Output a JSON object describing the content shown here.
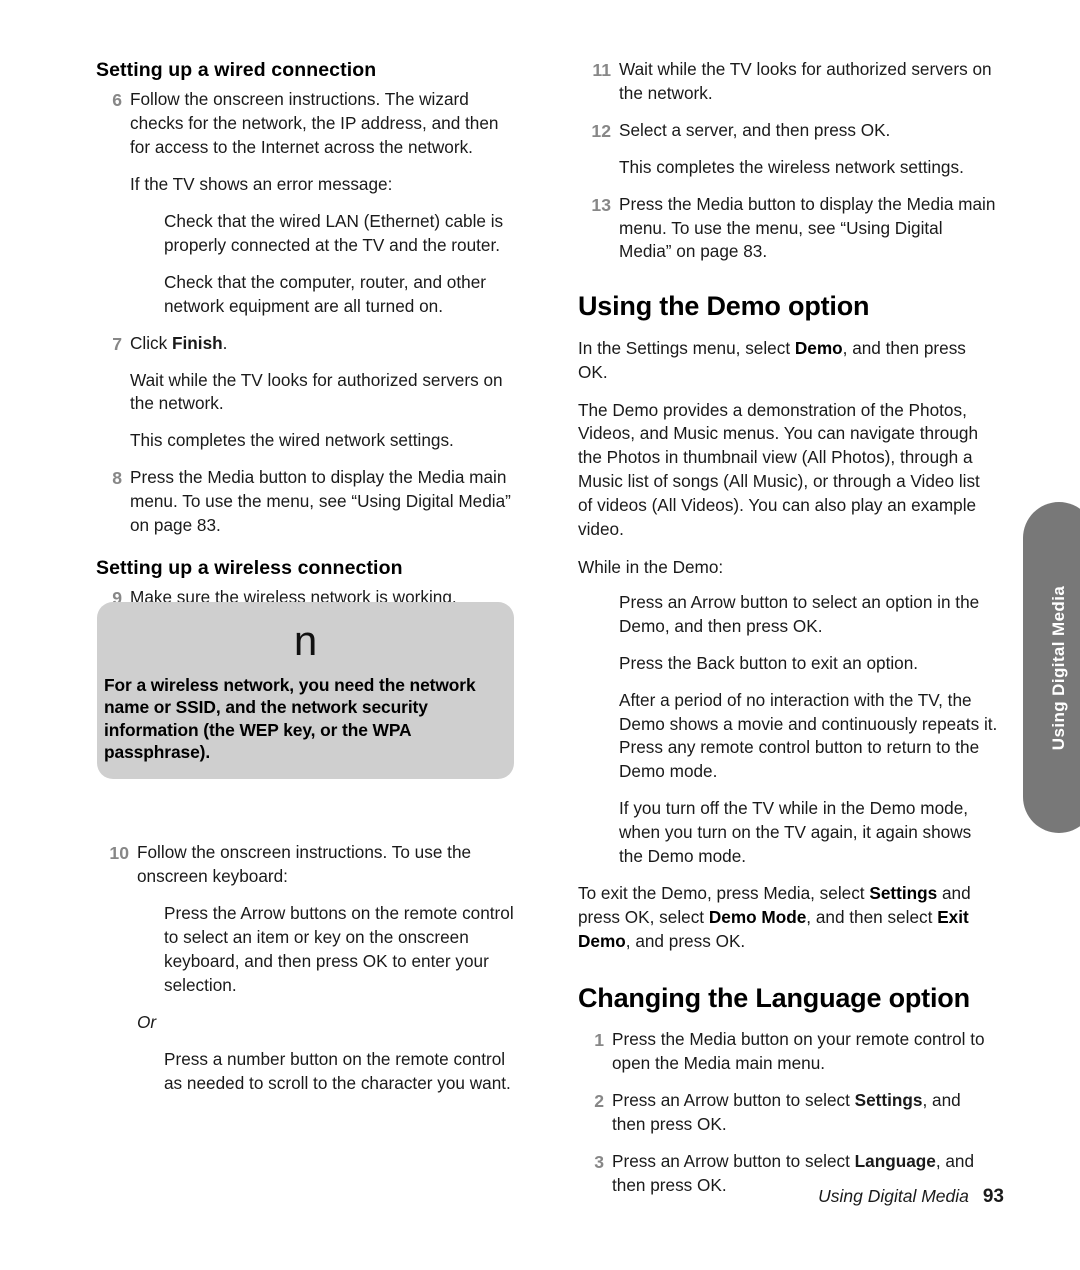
{
  "document": {
    "page_number": "93",
    "footer_title": "Using Digital Media",
    "side_tab_label": "Using Digital Media"
  },
  "left_column": {
    "heading_wired": "Setting up a wired connection",
    "step6": {
      "number": "6",
      "text": "Follow the onscreen instructions. The wizard checks for the network, the IP address, and then for access to the Internet across the network."
    },
    "error_intro": "If the TV shows an error message:",
    "error_item_1": "Check that the wired LAN (Ethernet) cable is properly connected at the TV and the router.",
    "error_item_2": "Check that the computer, router, and other network equipment are all turned on.",
    "step7": {
      "number": "7",
      "text_prefix": "Click ",
      "text_bold": "Finish",
      "text_suffix": "."
    },
    "after_step7_a": "Wait while the TV looks for authorized servers on the network.",
    "after_step7_b": "This completes the wired network settings.",
    "step8": {
      "number": "8",
      "text": "Press the Media button to display the Media main menu. To use the menu, see “Using Digital Media” on page 83."
    },
    "heading_wireless": "Setting up a wireless connection",
    "step9": {
      "number": "9",
      "text": "Make sure the wireless network is working."
    },
    "note": {
      "glyph": "n",
      "glyph_name": "note-symbol",
      "text": "For a wireless network, you need the network name or SSID, and the network security information (the WEP key, or the WPA passphrase).",
      "background_color": "#cfcfcf"
    },
    "step10": {
      "number": "10",
      "text": "Follow the onscreen instructions. To use the onscreen keyboard:"
    },
    "keyboard_item_1": "Press the Arrow buttons on the remote control to select an item or key on the onscreen keyboard, and then press OK to enter your selection.",
    "or_label": "Or",
    "keyboard_item_2": "Press a number button on the remote control as needed to scroll to the character you want."
  },
  "right_column": {
    "step11": {
      "number": "11",
      "text": "Wait while the TV looks for authorized servers on the network."
    },
    "step12": {
      "number": "12",
      "text": "Select a server, and then press OK."
    },
    "after_step12": "This completes the wireless network settings.",
    "step13": {
      "number": "13",
      "text": "Press the Media button to display the Media main menu. To use the menu, see “Using Digital Media” on page 83."
    },
    "heading_demo": "Using the Demo option",
    "demo_intro_prefix": "In the Settings menu, select ",
    "demo_intro_bold": "Demo",
    "demo_intro_suffix": ", and then press OK.",
    "demo_desc": "The Demo provides a demonstration of the Photos, Videos, and Music menus. You can navigate through the Photos in thumbnail view (All Photos), through a Music list of songs (All Music), or through a Video list of videos (All Videos). You can also play an example video.",
    "while_demo_intro": "While in the Demo:",
    "demo_item_1": "Press an Arrow button to select an option in the Demo, and then press OK.",
    "demo_item_2": "Press the Back button to exit an option.",
    "demo_item_3": "After a period of no interaction with the TV, the Demo shows a movie and continuously repeats it. Press any remote control button to return to the Demo mode.",
    "demo_item_4": "If you turn off the TV while in the Demo mode, when you turn on the TV again, it again shows the Demo mode.",
    "exit_demo": {
      "p1": "To exit the Demo, press Media, select ",
      "b1": "Settings",
      "p2": " and press OK, select ",
      "b2": "Demo Mode",
      "p3": ", and then select ",
      "b3": "Exit Demo",
      "p4": ", and press OK."
    },
    "heading_language": "Changing the Language option",
    "lang_step1": {
      "number": "1",
      "text": "Press the Media button on your remote control to open the Media main menu."
    },
    "lang_step2": {
      "number": "2",
      "prefix": "Press an Arrow button to select ",
      "bold": "Settings",
      "suffix": ", and then press OK."
    },
    "lang_step3": {
      "number": "3",
      "prefix": "Press an Arrow button to select ",
      "bold": "Language",
      "suffix": ", and then press OK."
    }
  }
}
